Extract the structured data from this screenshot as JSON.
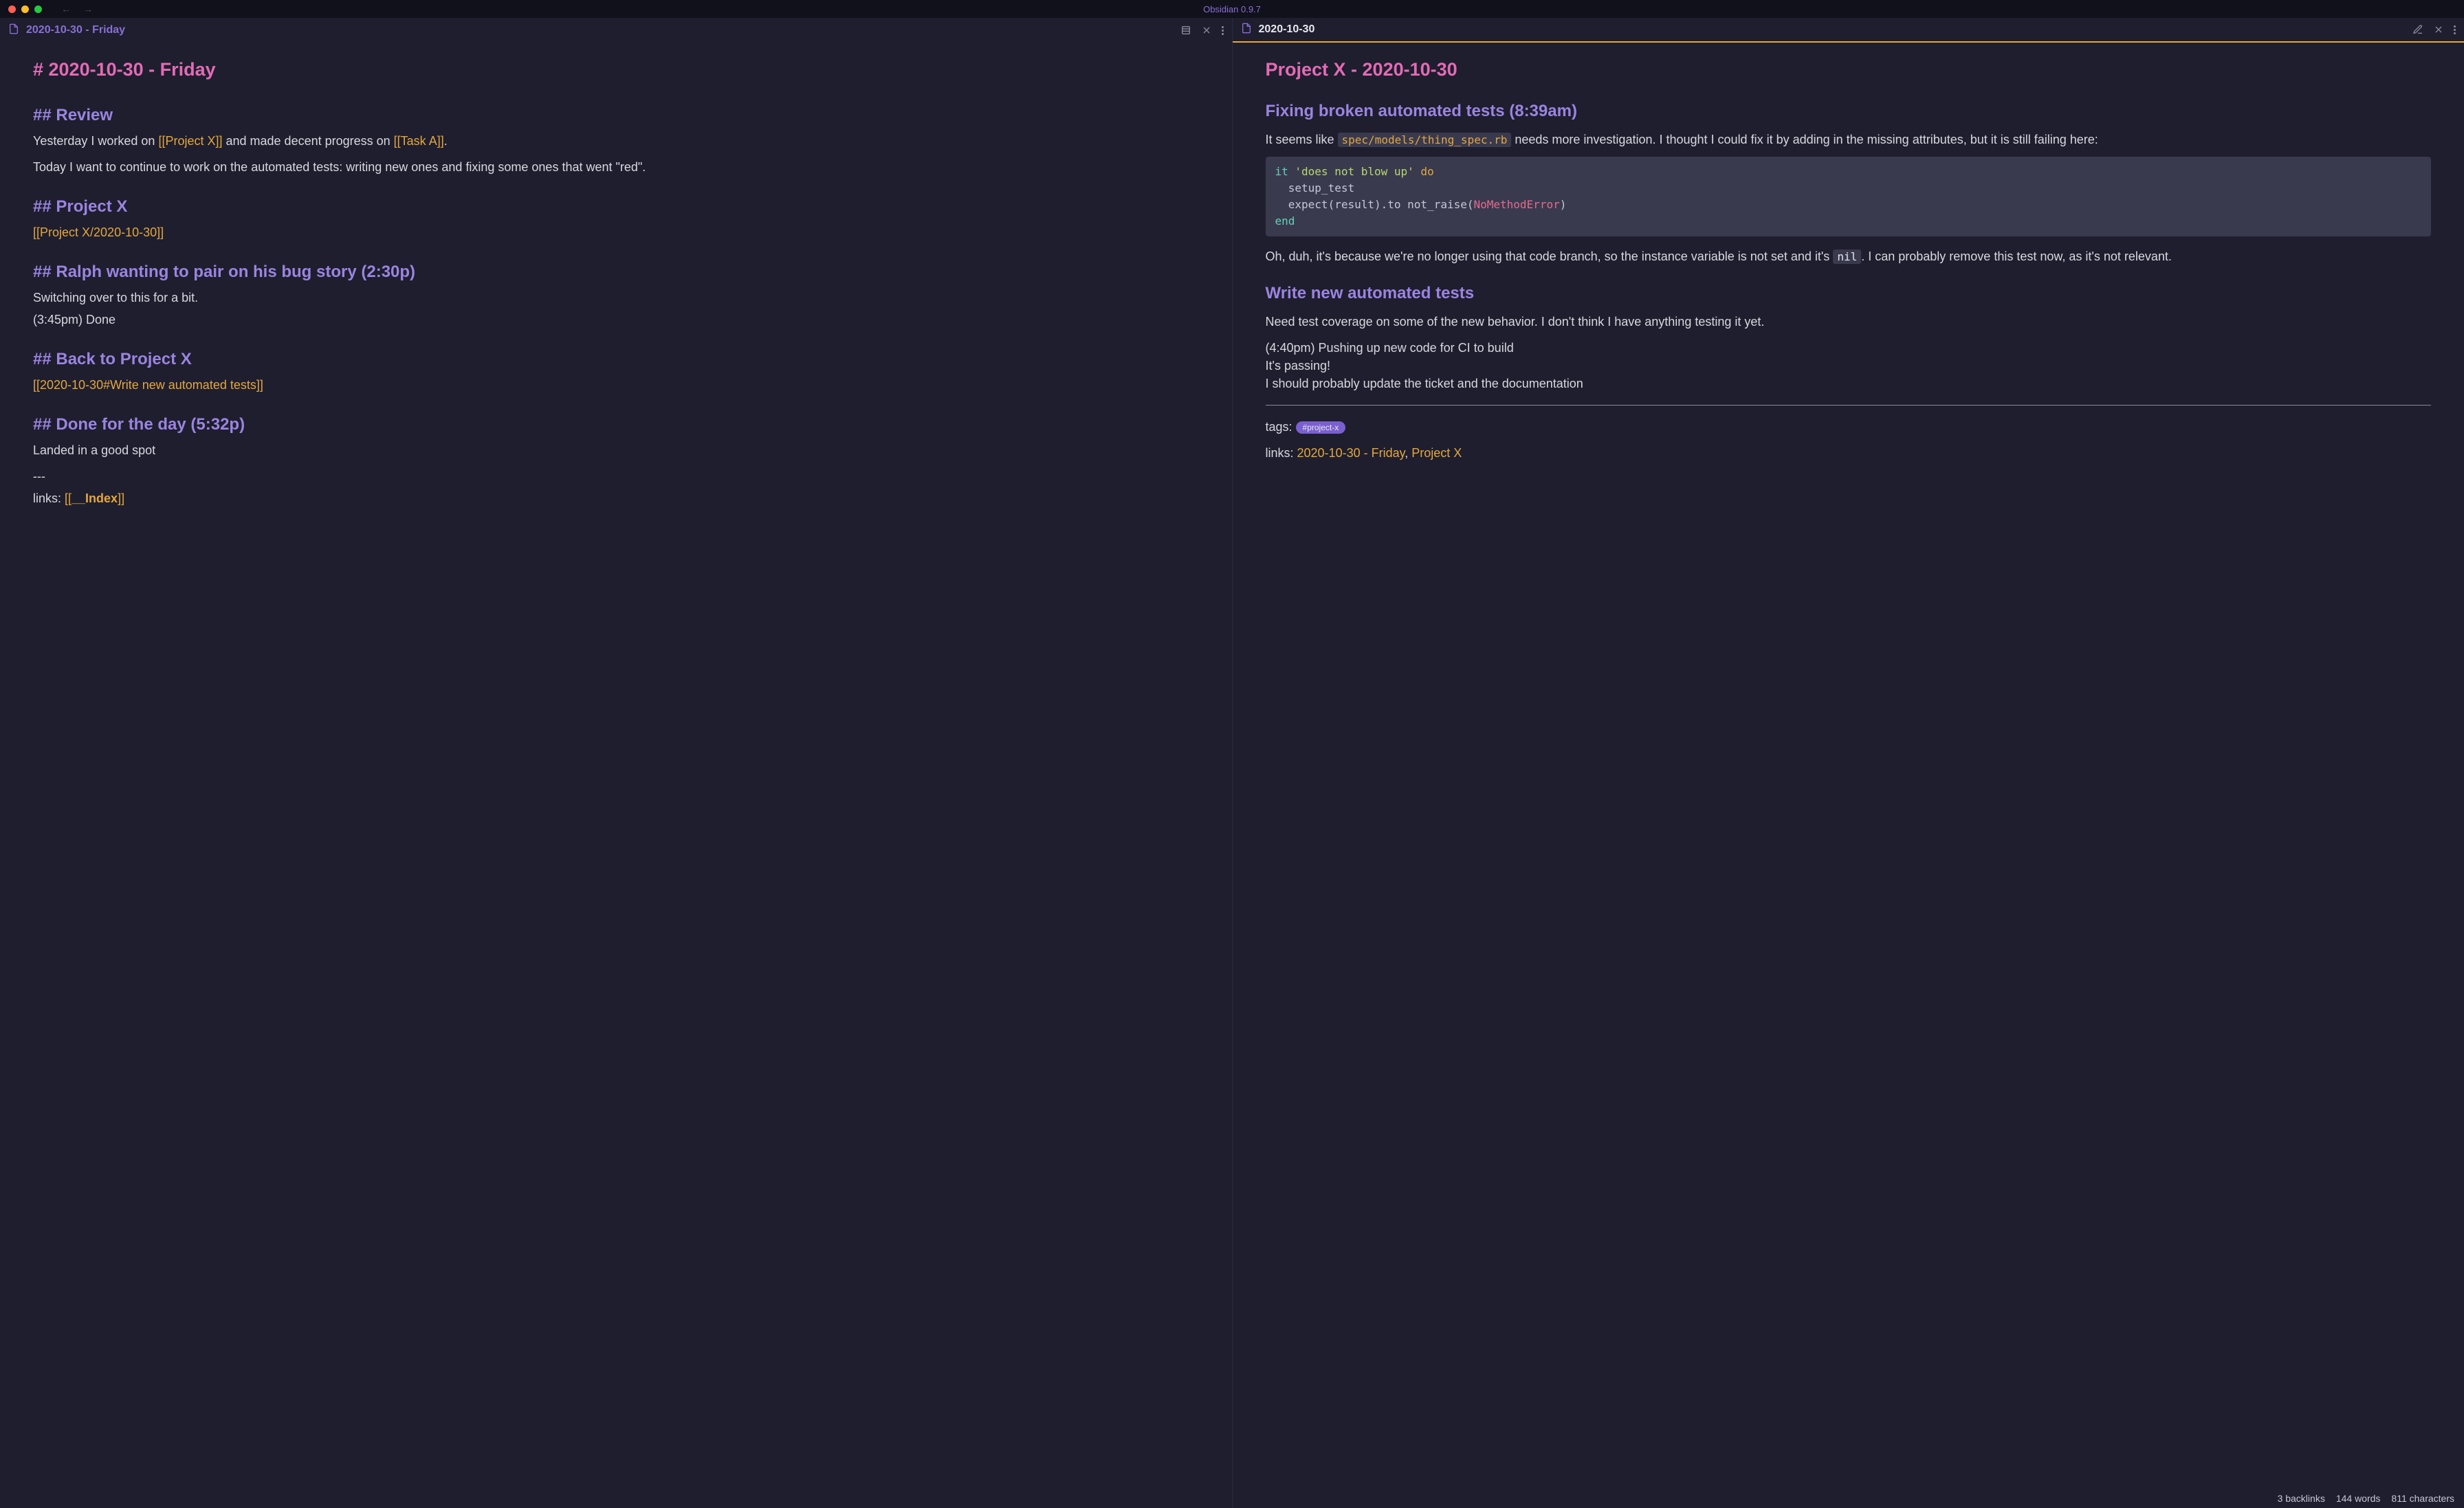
{
  "app": {
    "title": "Obsidian 0.9.7"
  },
  "left": {
    "tab_title": "2020-10-30 - Friday",
    "h1": "# 2020-10-30 - Friday",
    "review_h": "## Review",
    "review_p1_a": "Yesterday I worked on ",
    "review_link1": "[[Project X]]",
    "review_p1_b": " and made decent progress on ",
    "review_link2": "[[Task A]]",
    "review_p1_c": ".",
    "review_p2": "Today I want to continue to work on the automated tests: writing new ones and fixing some ones that went \"red\".",
    "projx_h": "## Project X",
    "projx_link": "[[Project X/2020-10-30]]",
    "ralph_h": "## Ralph wanting to pair on his bug story (2:30p)",
    "ralph_p1": "Switching over to this for a bit.",
    "ralph_p2": "(3:45pm) Done",
    "back_h": "## Back to Project X",
    "back_link": "[[2020-10-30#Write new automated tests]]",
    "done_h": "## Done for the day (5:32p)",
    "done_p": "Landed in a good spot",
    "dashes": "---",
    "links_label": "links: ",
    "links_link_open": "[[",
    "links_link_bold": "__Index",
    "links_link_close": "]]"
  },
  "right": {
    "tab_title": "2020-10-30",
    "h1": "Project X - 2020-10-30",
    "fix_h": "Fixing broken automated tests (8:39am)",
    "fix_p1_a": "It seems like ",
    "fix_code1": "spec/models/thing_spec.rb",
    "fix_p1_b": " needs more investigation. I thought I could fix it by adding in the missing attributes, but it is still failing here:",
    "code": {
      "l1_kw": "it",
      "l1_str": " 'does not blow up' ",
      "l1_do": "do",
      "l2": "  setup_test",
      "l3_a": "  expect(result).to not_raise(",
      "l3_err": "NoMethodError",
      "l3_b": ")",
      "l4": "end"
    },
    "fix_p2_a": "Oh, duh, it's because we're no longer using that code branch, so the instance variable is not set and it's ",
    "fix_nil": "nil",
    "fix_p2_b": ". I can probably remove this test now, as it's not relevant.",
    "new_h": "Write new automated tests",
    "new_p1": "Need test coverage on some of the new behavior. I don't think I have anything testing it yet.",
    "new_p2": "(4:40pm) Pushing up new code for CI to build",
    "new_p3": "It's passing!",
    "new_p4": "I should probably update the ticket and the documentation",
    "tags_label": "tags: ",
    "tag_pill": "#project-x",
    "links_label": "links: ",
    "link1": "2020-10-30 - Friday",
    "link_sep": ", ",
    "link2": "Project X"
  },
  "status": {
    "backlinks": "3 backlinks",
    "words": "144 words",
    "chars": "811 characters"
  }
}
